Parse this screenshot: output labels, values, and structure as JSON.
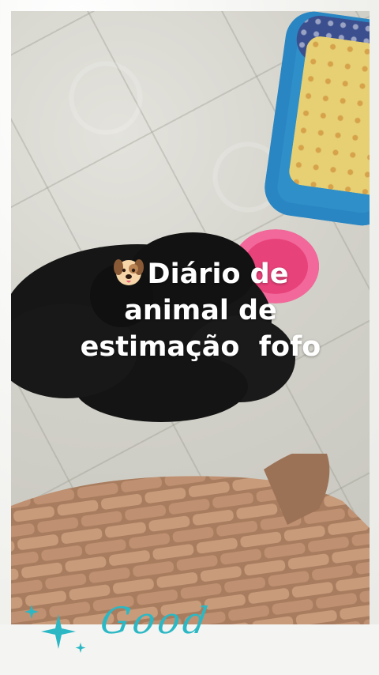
{
  "overlay": {
    "emoji": "dog-face",
    "lines": [
      "Diário de",
      "animal de",
      "estimação  fofo"
    ]
  },
  "decoration": {
    "script_text": "Good",
    "accent_color": "#2bb8c4"
  },
  "colors": {
    "bowl": "#e8427a",
    "bed": "#2f8fc8",
    "dog": "#141414",
    "chair": "#b88a6a"
  }
}
